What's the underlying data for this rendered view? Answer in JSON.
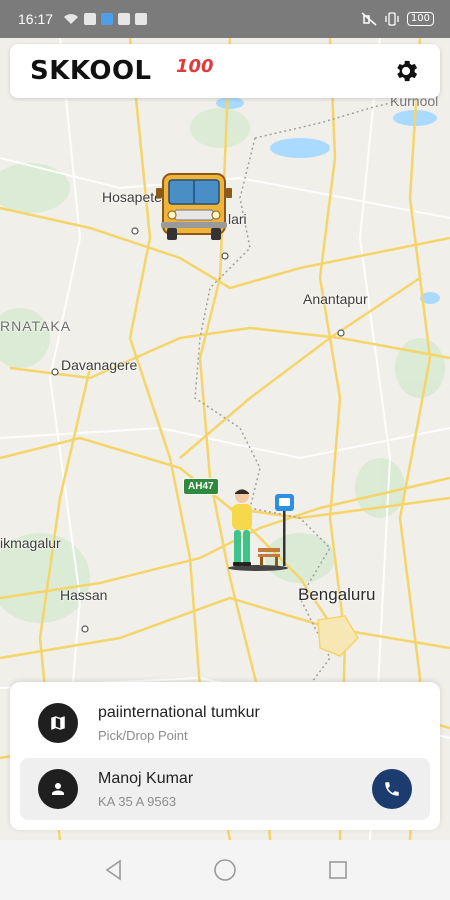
{
  "status_bar": {
    "time": "16:17",
    "battery": "100",
    "icons_left": [
      "wifi-icon",
      "sim-icon",
      "bluetooth-app-icon",
      "app-store-icon",
      "gallery-icon"
    ],
    "icons_right": [
      "mute-vibrate-icon",
      "vibrate-icon",
      "battery-icon"
    ]
  },
  "header": {
    "logo_text": "SKKOOL",
    "logo_badge": "100",
    "settings_icon": "gear-icon"
  },
  "map": {
    "labels": {
      "hosapete": "Hosapete",
      "ballari": "lari",
      "anantapur": "Anantapur",
      "karnataka": "RNATAKA",
      "davanagere": "Davanagere",
      "chikmagalur": "ikmagalur",
      "hassan": "Hassan",
      "bengaluru": "Bengaluru",
      "kurnool": "Kurnool",
      "highway": "AH47"
    },
    "markers": [
      "bus-marker",
      "student-bus-stop-marker"
    ]
  },
  "bottom_sheet": {
    "pickup": {
      "icon": "map-icon",
      "title": "paiinternational tumkur",
      "subtitle": "Pick/Drop Point"
    },
    "driver": {
      "icon": "person-icon",
      "name": "Manoj Kumar",
      "vehicle": "KA 35 A 9563",
      "call_icon": "phone-icon"
    }
  },
  "nav": {
    "buttons": [
      "back-icon",
      "home-icon",
      "recents-icon"
    ]
  },
  "colors": {
    "accent_call": "#1c3b6e",
    "icon_dark": "#1f1f1f",
    "road_yellow": "#f5d56a",
    "map_bg": "#f1efe9"
  }
}
